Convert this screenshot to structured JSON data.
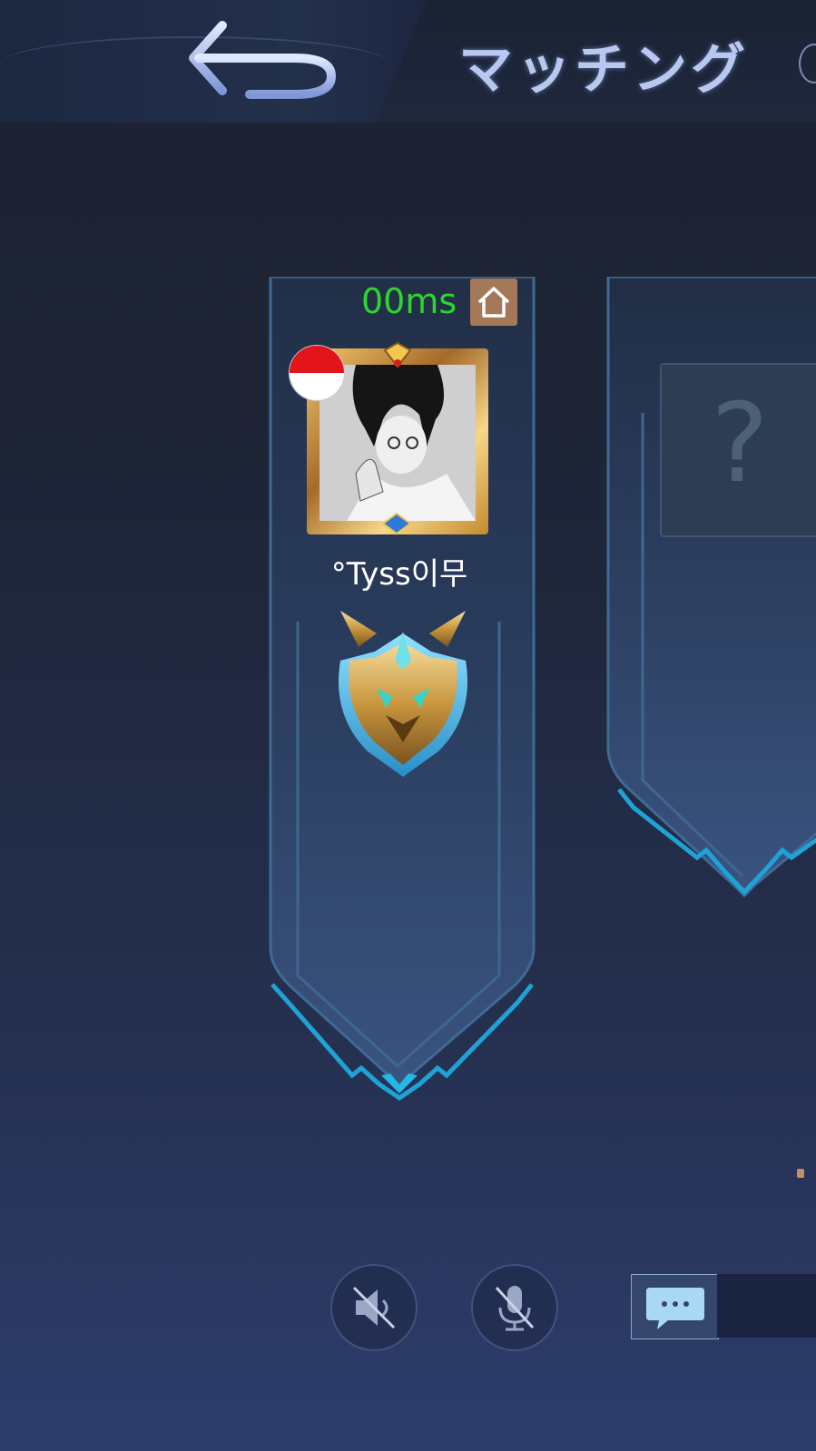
{
  "header": {
    "title": "マッチング",
    "back_icon": "back-arrow-icon"
  },
  "slot_main": {
    "ping": "00ms",
    "home_icon": "home-icon",
    "flag": "indonesia-flag",
    "player_name": "°Tyss이무",
    "rank_icon": "mythic-rank-emblem-icon"
  },
  "slot_next": {
    "placeholder_icon": "question-mark-icon",
    "placeholder_text": "?"
  },
  "controls": {
    "speaker_icon": "speaker-muted-icon",
    "mic_icon": "mic-muted-icon",
    "chat_icon": "chat-bubble-icon"
  },
  "colors": {
    "ping": "#2ed52e",
    "accent": "#1fa2d6",
    "home_bg": "#a4795a"
  }
}
